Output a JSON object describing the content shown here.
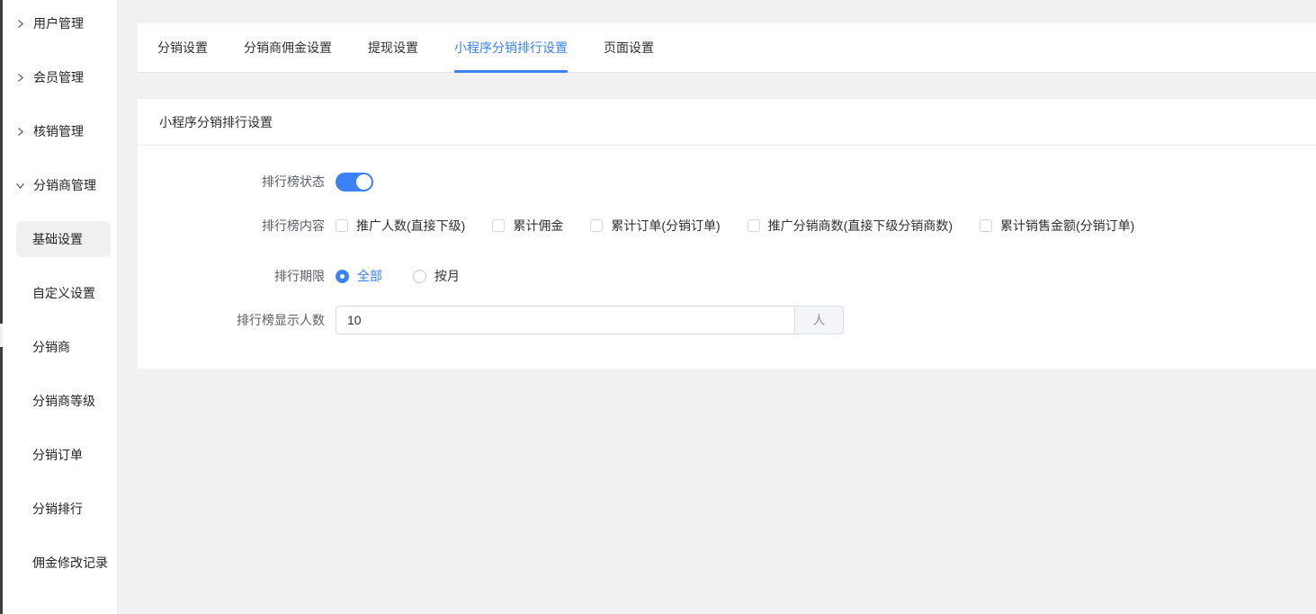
{
  "colors": {
    "accent": "#3b82f6",
    "page_bg": "#f0f1f2",
    "card_bg": "#ffffff",
    "text_dark": "#303133",
    "text_label": "#5a5e66",
    "edge_strip": "#3e3e40",
    "sidebar_active_bg": "#eef0f2"
  },
  "sidebar": {
    "groups": [
      {
        "label": "用户管理",
        "state": "collapsed"
      },
      {
        "label": "会员管理",
        "state": "collapsed"
      },
      {
        "label": "核销管理",
        "state": "collapsed"
      },
      {
        "label": "分销商管理",
        "state": "expanded"
      }
    ],
    "submenu": [
      {
        "label": "基础设置",
        "active": true
      },
      {
        "label": "自定义设置",
        "active": false
      },
      {
        "label": "分销商",
        "active": false
      },
      {
        "label": "分销商等级",
        "active": false
      },
      {
        "label": "分销订单",
        "active": false
      },
      {
        "label": "分销排行",
        "active": false
      },
      {
        "label": "佣金修改记录",
        "active": false
      }
    ]
  },
  "tabs": [
    {
      "label": "分销设置",
      "active": false
    },
    {
      "label": "分销商佣金设置",
      "active": false
    },
    {
      "label": "提现设置",
      "active": false
    },
    {
      "label": "小程序分销排行设置",
      "active": true
    },
    {
      "label": "页面设置",
      "active": false
    }
  ],
  "panel": {
    "title": "小程序分销排行设置",
    "form": {
      "status": {
        "label": "排行榜状态",
        "on": true
      },
      "content": {
        "label": "排行榜内容",
        "options": [
          {
            "label": "推广人数(直接下级)",
            "checked": false
          },
          {
            "label": "累计佣金",
            "checked": false
          },
          {
            "label": "累计订单(分销订单)",
            "checked": false
          },
          {
            "label": "推广分销商数(直接下级分销商数)",
            "checked": false
          },
          {
            "label": "累计销售金额(分销订单)",
            "checked": false
          }
        ]
      },
      "period": {
        "label": "排行期限",
        "options": [
          {
            "label": "全部",
            "selected": true
          },
          {
            "label": "按月",
            "selected": false
          }
        ]
      },
      "display_count": {
        "label": "排行榜显示人数",
        "value": "10",
        "unit": "人"
      }
    }
  }
}
